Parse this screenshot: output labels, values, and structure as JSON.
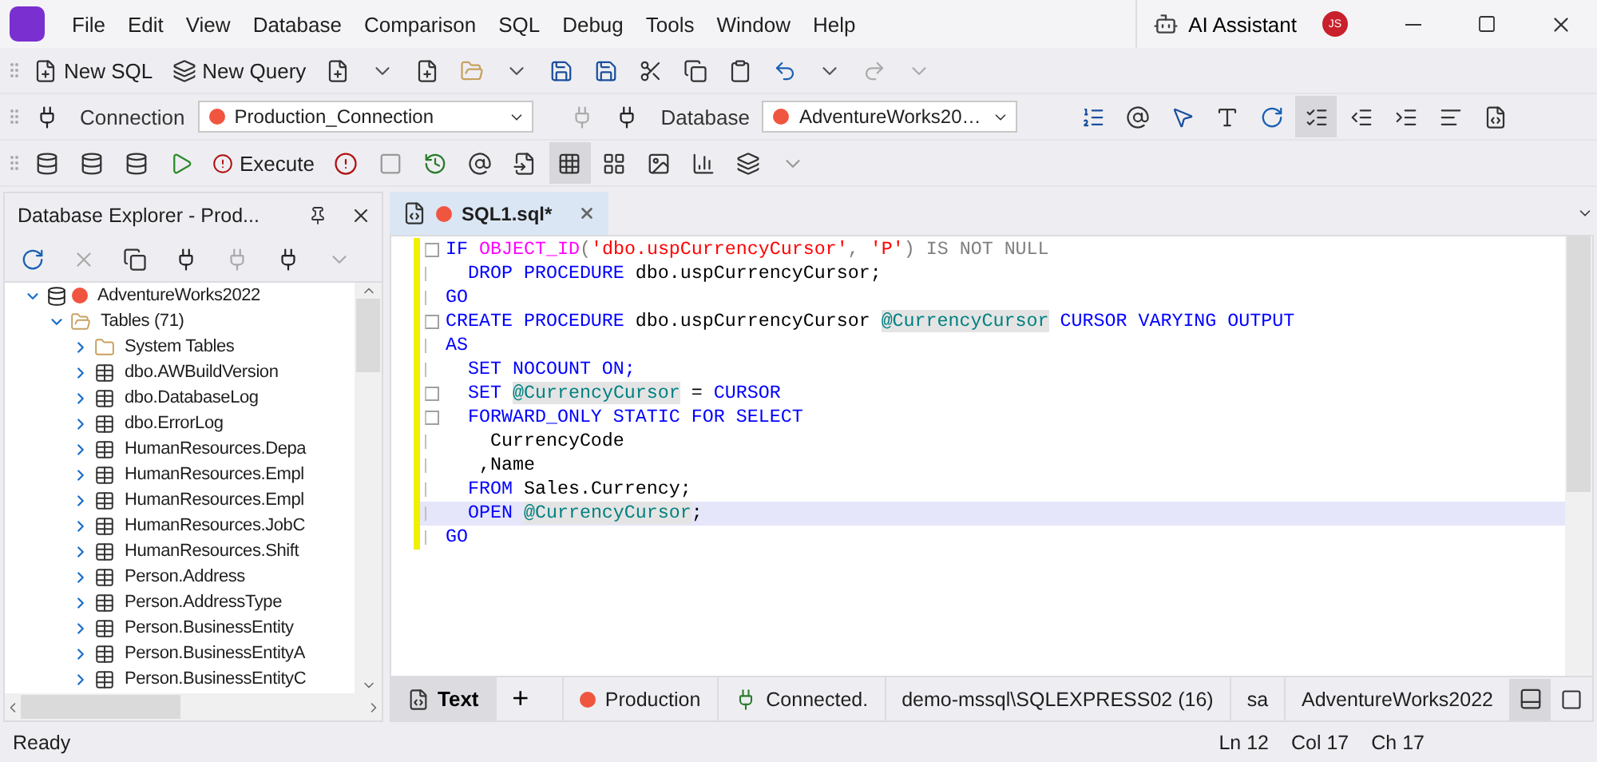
{
  "menu": [
    "File",
    "Edit",
    "View",
    "Database",
    "Comparison",
    "SQL",
    "Debug",
    "Tools",
    "Window",
    "Help"
  ],
  "title_bar": {
    "assistant": "AI Assistant",
    "avatar": "JS"
  },
  "toolbar_main": {
    "new_sql": "New SQL",
    "new_query": "New Query"
  },
  "toolbar_connection": {
    "connection_label": "Connection",
    "connection": {
      "value": "Production_Connection",
      "color": "#f05540"
    },
    "database_label": "Database",
    "database": {
      "value": "AdventureWorks20…",
      "color": "#f05540"
    },
    "format_pressed": true
  },
  "toolbar_execute": {
    "execute": "Execute",
    "grid_pressed": true
  },
  "explorer": {
    "title": "Database Explorer - Prod...",
    "tree": [
      {
        "kind": "database",
        "label": "AdventureWorks2022",
        "color": "#f05540",
        "expanded": true,
        "children": [
          {
            "kind": "folder",
            "label": "Tables (71)",
            "expanded": true,
            "children": [
              {
                "kind": "folder",
                "label": "System Tables",
                "expanded": false
              },
              {
                "kind": "table",
                "label": "dbo.AWBuildVersion",
                "expanded": false
              },
              {
                "kind": "table",
                "label": "dbo.DatabaseLog",
                "expanded": false
              },
              {
                "kind": "table",
                "label": "dbo.ErrorLog",
                "expanded": false
              },
              {
                "kind": "table",
                "label": "HumanResources.Depa",
                "expanded": false
              },
              {
                "kind": "table",
                "label": "HumanResources.Empl",
                "expanded": false
              },
              {
                "kind": "table",
                "label": "HumanResources.Empl",
                "expanded": false
              },
              {
                "kind": "table",
                "label": "HumanResources.JobC",
                "expanded": false
              },
              {
                "kind": "table",
                "label": "HumanResources.Shift",
                "expanded": false
              },
              {
                "kind": "table",
                "label": "Person.Address",
                "expanded": false
              },
              {
                "kind": "table",
                "label": "Person.AddressType",
                "expanded": false
              },
              {
                "kind": "table",
                "label": "Person.BusinessEntity",
                "expanded": false
              },
              {
                "kind": "table",
                "label": "Person.BusinessEntityA",
                "expanded": false
              },
              {
                "kind": "table",
                "label": "Person.BusinessEntityC",
                "expanded": false
              }
            ]
          }
        ]
      }
    ]
  },
  "editor": {
    "tabs": [
      {
        "title": "SQL1.sql*",
        "color": "#f05540",
        "selected": true
      }
    ],
    "lines": [
      {
        "fold": true,
        "current": false,
        "tokens": [
          {
            "kind": "keyword",
            "text": "IF "
          },
          {
            "kind": "function",
            "text": "OBJECT_ID"
          },
          {
            "kind": "operator",
            "text": "("
          },
          {
            "kind": "string",
            "text": "'dbo.uspCurrencyCursor'"
          },
          {
            "kind": "operator",
            "text": ", "
          },
          {
            "kind": "string",
            "text": "'P'"
          },
          {
            "kind": "operator",
            "text": ") IS NOT NULL"
          }
        ]
      },
      {
        "fold": false,
        "current": false,
        "tokens": [
          {
            "kind": "keyword",
            "text": "  DROP PROCEDURE "
          },
          {
            "kind": "plain",
            "text": "dbo.uspCurrencyCursor;"
          }
        ]
      },
      {
        "fold": false,
        "current": false,
        "tokens": [
          {
            "kind": "keyword",
            "text": "GO"
          }
        ]
      },
      {
        "fold": true,
        "current": false,
        "tokens": [
          {
            "kind": "keyword",
            "text": "CREATE PROCEDURE "
          },
          {
            "kind": "plain",
            "text": "dbo.uspCurrencyCursor "
          },
          {
            "kind": "variable",
            "text": "@CurrencyCursor"
          },
          {
            "kind": "keyword",
            "text": " CURSOR VARYING OUTPUT"
          }
        ]
      },
      {
        "fold": false,
        "current": false,
        "tokens": [
          {
            "kind": "keyword",
            "text": "AS"
          }
        ]
      },
      {
        "fold": false,
        "current": false,
        "tokens": [
          {
            "kind": "keyword",
            "text": "  SET NOCOUNT ON;"
          }
        ]
      },
      {
        "fold": true,
        "current": false,
        "tokens": [
          {
            "kind": "keyword",
            "text": "  SET "
          },
          {
            "kind": "variable",
            "text": "@CurrencyCursor"
          },
          {
            "kind": "plain",
            "text": " = "
          },
          {
            "kind": "keyword",
            "text": "CURSOR"
          }
        ]
      },
      {
        "fold": true,
        "current": false,
        "tokens": [
          {
            "kind": "keyword",
            "text": "  FORWARD_ONLY STATIC FOR SELECT"
          }
        ]
      },
      {
        "fold": false,
        "current": false,
        "tokens": [
          {
            "kind": "plain",
            "text": "    CurrencyCode"
          }
        ]
      },
      {
        "fold": false,
        "current": false,
        "tokens": [
          {
            "kind": "plain",
            "text": "   ,Name"
          }
        ]
      },
      {
        "fold": false,
        "current": false,
        "tokens": [
          {
            "kind": "keyword",
            "text": "  FROM "
          },
          {
            "kind": "plain",
            "text": "Sales.Currency;"
          }
        ]
      },
      {
        "fold": false,
        "current": true,
        "tokens": [
          {
            "kind": "keyword",
            "text": "  OPEN "
          },
          {
            "kind": "variable",
            "text": "@CurrencyCursor"
          },
          {
            "kind": "plain",
            "text": ";"
          }
        ]
      },
      {
        "fold": false,
        "current": false,
        "tokens": [
          {
            "kind": "keyword",
            "text": "GO"
          }
        ]
      }
    ],
    "bottom_tabs": [
      {
        "label": "Text",
        "selected": true
      }
    ],
    "add_tab": "+",
    "info": [
      {
        "kind": "connection",
        "text": "Production",
        "color": "#f05540"
      },
      {
        "kind": "status",
        "text": "Connected."
      },
      {
        "kind": "plain",
        "text": "demo-mssql\\SQLEXPRESS02 (16)"
      },
      {
        "kind": "plain",
        "text": "sa"
      },
      {
        "kind": "plain",
        "text": "AdventureWorks2022"
      }
    ]
  },
  "status_bar": {
    "message": "Ready",
    "line": "Ln 12",
    "column": "Col 17",
    "char": "Ch 17"
  }
}
